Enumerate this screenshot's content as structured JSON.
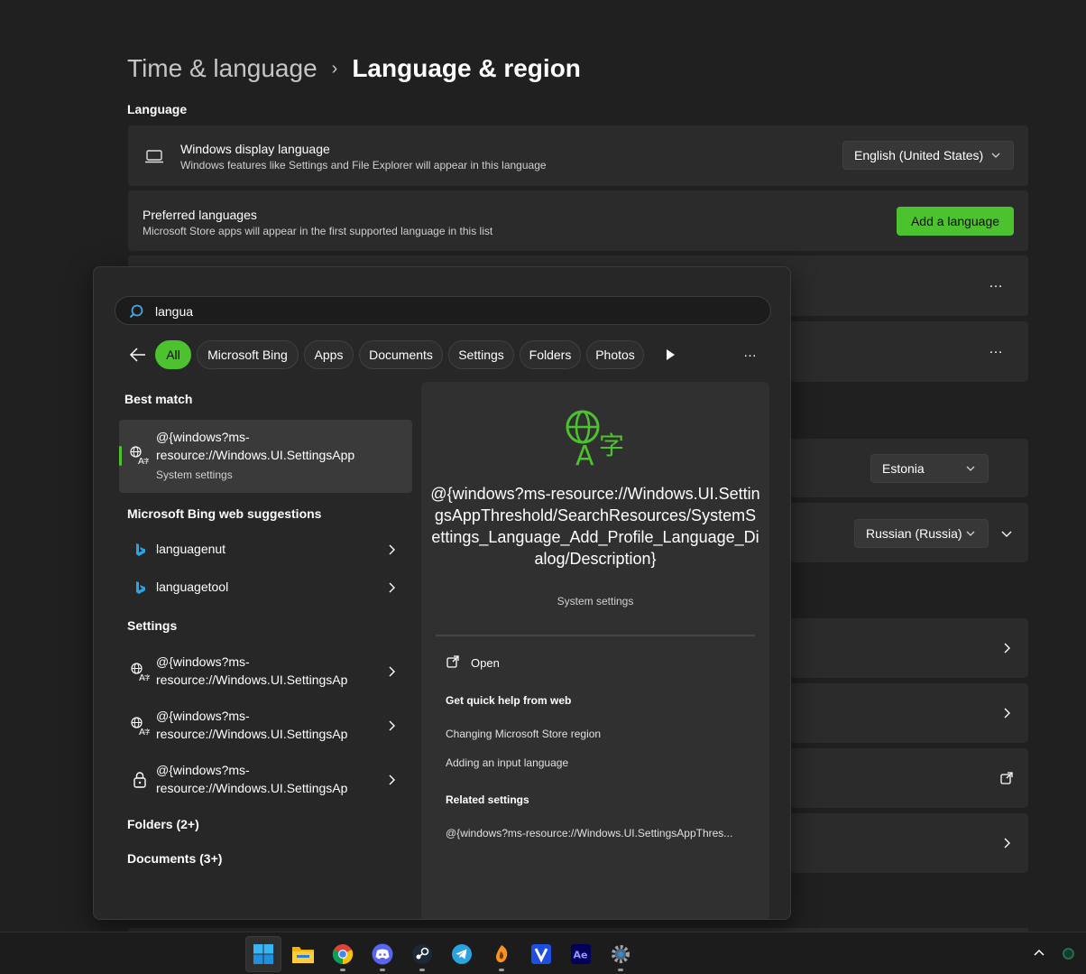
{
  "settings": {
    "breadcrumb_parent": "Time & language",
    "breadcrumb_separator": "›",
    "page_title": "Language & region",
    "section_language": "Language",
    "display_language": {
      "title": "Windows display language",
      "description": "Windows features like Settings and File Explorer will appear in this language",
      "value": "English (United States)",
      "icon": "laptop-icon"
    },
    "preferred_languages": {
      "title": "Preferred languages",
      "description": "Microsoft Store apps will appear in the first supported language in this list",
      "button": "Add a language"
    },
    "more_options": "…",
    "country_value": "Estonia",
    "regional_format_value": "Russian (Russia)"
  },
  "search": {
    "query": "langua",
    "filters": [
      "All",
      "Microsoft Bing",
      "Apps",
      "Documents",
      "Settings",
      "Folders",
      "Photos"
    ],
    "more": "…",
    "best_match_heading": "Best match",
    "best_match": {
      "line1": "@{windows?ms-",
      "line2": "resource://Windows.UI.SettingsApp",
      "sub": "System settings"
    },
    "bing_heading": "Microsoft Bing web suggestions",
    "bing_items": [
      "languagenut",
      "languagetool"
    ],
    "settings_heading": "Settings",
    "settings_items": [
      {
        "line1": "@{windows?ms-",
        "line2": "resource://Windows.UI.SettingsAp",
        "icon": "language-settings-icon"
      },
      {
        "line1": "@{windows?ms-",
        "line2": "resource://Windows.UI.SettingsAp",
        "icon": "language-settings-icon"
      },
      {
        "line1": "@{windows?ms-",
        "line2": "resource://Windows.UI.SettingsAp",
        "icon": "lock-icon"
      }
    ],
    "folders_heading": "Folders (2+)",
    "documents_heading": "Documents (3+)",
    "preview": {
      "title": "@{windows?ms-resource://Windows.UI.SettingsAppThreshold/SearchResources/SystemSettings_Language_Add_Profile_Language_Dialog/Description}",
      "subtitle": "System settings",
      "open_label": "Open",
      "quick_help_heading": "Get quick help from web",
      "help_links": [
        "Changing Microsoft Store region",
        "Adding an input language"
      ],
      "related_heading": "Related settings",
      "related_item": "@{windows?ms-resource://Windows.UI.SettingsAppThres..."
    }
  },
  "taskbar": {
    "apps": [
      "start",
      "file-explorer",
      "chrome",
      "discord",
      "steam",
      "telegram",
      "fl-studio",
      "v-app",
      "after-effects",
      "settings"
    ]
  },
  "colors": {
    "accent": "#4cc22e",
    "background": "#202020",
    "card": "#2b2b2b",
    "flyout": "#272727"
  }
}
